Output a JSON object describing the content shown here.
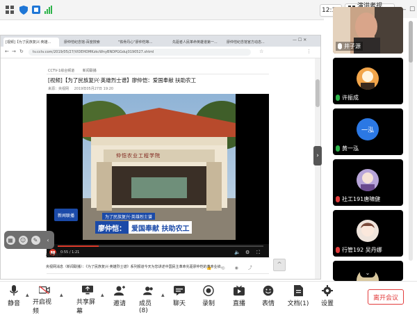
{
  "status_bar": {
    "icons": [
      "tile-grid-icon",
      "shield-icon",
      "cast-icon",
      "signal-icon"
    ],
    "clock": "12:30",
    "presenter_view": "演讲者视图",
    "colors": {
      "accent": "#1e76d6",
      "signal": "#2db34a"
    }
  },
  "browser": {
    "tabs": [
      "[视频]【为了民族复兴·英雄...",
      "廖仲恺纪念馆-百度搜索",
      "\"铁骨丹心\"廖仲恺等...",
      "先驱者人民革命英雄谱第一...",
      "廖仲恺纪念馆官方动态..."
    ],
    "url": "tv.cctv.com/2019/05/27/VIDEHDMKzkcWnyBNDPGGduj0190527.shtml",
    "page": {
      "breadcrumb_left": "CCTV-1综合频道",
      "breadcrumb_right": "新闻联播",
      "headline": "[视频]【为了民族复兴·英雄烈士谱】廖仲恺：爱国奉献 扶助农工",
      "meta_source": "来源：央视网",
      "meta_date": "2019年05月27日 19:20",
      "video": {
        "gate_text": "仲恺农业工程学院",
        "logo": "新闻联播",
        "caption_top": "为了民族复兴·英雄烈士谱",
        "caption_name": "廖仲恺：",
        "caption_main": "爱国奉献 扶助农工",
        "time": "0:55 / 1:21",
        "progress": 0.2,
        "colors": {
          "caption_red": "#c8102e",
          "caption_blue": "#1b4aa8"
        }
      },
      "related_heading": "相关稿件",
      "paragraph": "央视网消息（新闻联播）：《为了民族复兴·英雄烈士谱》系列报道今天为您讲述中国民主革命先驱廖仲恺的革命业绩。"
    }
  },
  "participants": [
    {
      "name": "井子源",
      "mic": "white",
      "type": "video"
    },
    {
      "name": "许振成",
      "mic": "green",
      "type": "avatar"
    },
    {
      "name": "黄一泓",
      "mic": "green",
      "type": "initials",
      "initials": "一泓",
      "color": "#2b78e4"
    },
    {
      "name": "社工191唐啸健",
      "mic": "red",
      "type": "avatar"
    },
    {
      "name": "行管192 吴丹娜",
      "mic": "red",
      "type": "avatar"
    }
  ],
  "toolbar": {
    "mute": "静音",
    "video": "开启视频",
    "share": "共享屏幕",
    "invite": "邀请",
    "members": "成员(8)",
    "chat": "聊天",
    "record": "录制",
    "live": "直播",
    "reactions": "表情",
    "docs": "文档(1)",
    "settings": "设置",
    "end": "离开会议"
  }
}
